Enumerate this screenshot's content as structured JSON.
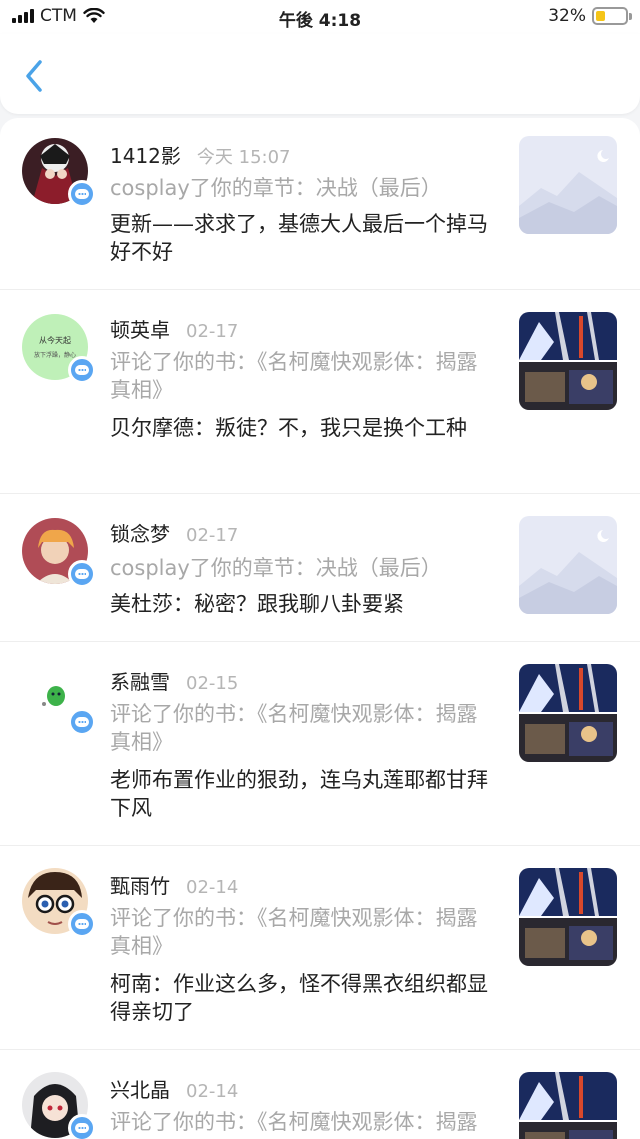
{
  "status_bar": {
    "carrier": "CTM",
    "time": "午後 4:18",
    "battery": "32%"
  },
  "header": {
    "back_icon": "chevron-left-icon"
  },
  "colors": {
    "accent": "#4aa3e8",
    "badge": "#5aa6f2",
    "muted_text": "#a8a8a8"
  },
  "notifications": [
    {
      "user": "1412影",
      "time": "今天 15:07",
      "action": "cosplay了你的章节：决战（最后）",
      "content": "更新——求求了，基德大人最后一个掉马好不好",
      "thumb": "placeholder-mountain"
    },
    {
      "user": "顿英卓",
      "time": "02-17",
      "action": "评论了你的书：《名柯魔快观影体：揭露真相》",
      "content": "贝尔摩德：叛徒？不，我只是换个工种",
      "thumb": "book-cover",
      "avatar_text": "从今天起",
      "avatar_subtext": "放下浮躁，静心"
    },
    {
      "user": "锁念梦",
      "time": "02-17",
      "action": "cosplay了你的章节：决战（最后）",
      "content": "美杜莎：秘密？跟我聊八卦要紧",
      "thumb": "placeholder-mountain"
    },
    {
      "user": "系融雪",
      "time": "02-15",
      "action": "评论了你的书：《名柯魔快观影体：揭露真相》",
      "content": "老师布置作业的狠劲，连乌丸莲耶都甘拜下风",
      "thumb": "book-cover"
    },
    {
      "user": "甄雨竹",
      "time": "02-14",
      "action": "评论了你的书：《名柯魔快观影体：揭露真相》",
      "content": "柯南：作业这么多，怪不得黑衣组织都显得亲切了",
      "thumb": "book-cover"
    },
    {
      "user": "兴北晶",
      "time": "02-14",
      "action": "评论了你的书：《名柯魔快观影体：揭露真相》",
      "content": "",
      "thumb": "book-cover"
    }
  ]
}
